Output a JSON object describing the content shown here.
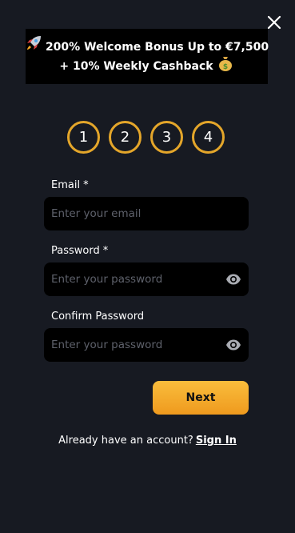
{
  "promo": {
    "line1": "200% Welcome Bonus Up to €7,500",
    "line2": "+ 10% Weekly Cashback",
    "icon_left": "rocket-icon",
    "icon_right": "money-bag-icon"
  },
  "steps": [
    "1",
    "2",
    "3",
    "4"
  ],
  "form": {
    "email_label": "Email",
    "email_placeholder": "Enter your email",
    "password_label": "Password",
    "password_placeholder": "Enter your password",
    "confirm_label": "Confirm Password",
    "confirm_placeholder": "Enter your password",
    "required_marker": "*"
  },
  "next_label": "Next",
  "signin": {
    "prompt": "Already have an account?",
    "link": "Sign In"
  },
  "colors": {
    "background": "#171a22",
    "accent": "#e4a62a",
    "button_gradient_top": "#f9bd3c",
    "button_gradient_bottom": "#ef9a1e",
    "field_bg": "#000000"
  }
}
